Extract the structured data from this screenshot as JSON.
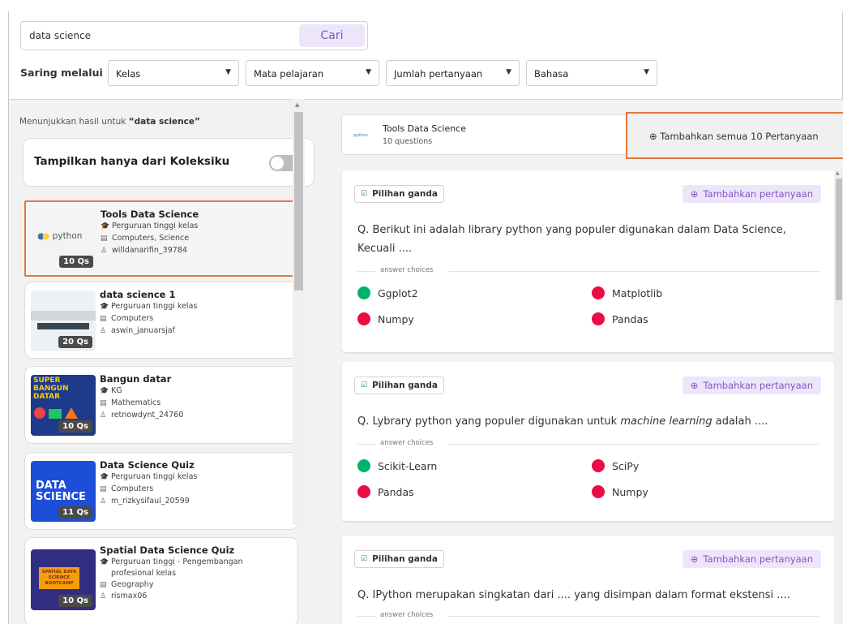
{
  "search": {
    "value": "data science",
    "button_label": "Cari"
  },
  "filters": {
    "label": "Saring melalui",
    "dropdowns": [
      {
        "label": "Kelas"
      },
      {
        "label": "Mata pelajaran"
      },
      {
        "label": "Jumlah pertanyaan"
      },
      {
        "label": "Bahasa"
      }
    ]
  },
  "left": {
    "results_prefix": "Menunjukkan hasil untuk",
    "results_query": "“data science”",
    "collection_toggle_label": "Tampilkan hanya dari Koleksiku",
    "quizzes": [
      {
        "title": "Tools Data Science",
        "grade": "Perguruan tinggi kelas",
        "subject": "Computers, Science",
        "author": "willdanarifin_39784",
        "badge": "10 Qs",
        "thumb_text": "python"
      },
      {
        "title": "data science 1",
        "grade": "Perguruan tinggi kelas",
        "subject": "Computers",
        "author": "aswin_januarsjaf",
        "badge": "20 Qs"
      },
      {
        "title": "Bangun datar",
        "grade": "KG",
        "subject": "Mathematics",
        "author": "retnowdynt_24760",
        "badge": "10 Qs",
        "thumb_text": "SUPER BANGUN DATAR"
      },
      {
        "title": "Data Science Quiz",
        "grade": "Perguruan tinggi kelas",
        "subject": "Computers",
        "author": "m_rizkysifaul_20599",
        "badge": "11 Qs",
        "thumb_text": "DATA SCIENCE"
      },
      {
        "title": "Spatial Data Science Quiz",
        "grade_line1": "Perguruan tinggi - Pengembangan",
        "grade_line2": "profesional kelas",
        "subject": "Geography",
        "author": "rismax06",
        "badge": "10 Qs",
        "thumb_text": "SPATIAL DATA SCIENCE BOOTCAMP"
      }
    ]
  },
  "right": {
    "header": {
      "title": "Tools Data Science",
      "subtitle": "10 questions",
      "add_all_label": "Tambahkan semua 10 Pertanyaan",
      "thumb_text": "python"
    },
    "type_label": "Pilihan ganda",
    "add_question_label": "Tambahkan pertanyaan",
    "answer_choices_label": "answer choices",
    "questions": [
      {
        "text": "Q. Berikut ini adalah library python yang populer digunakan dalam Data Science, Kecuali ....",
        "choices": [
          "Ggplot2",
          "Matplotlib",
          "Numpy",
          "Pandas"
        ]
      },
      {
        "text_prefix": "Q. Lybrary python yang populer digunakan untuk ",
        "text_em": "machine learning",
        "text_suffix": " adalah ....",
        "choices": [
          "Scikit-Learn",
          "SciPy",
          "Pandas",
          "Numpy"
        ]
      },
      {
        "text": "Q. IPython merupakan singkatan dari .... yang disimpan dalam format ekstensi ...."
      }
    ]
  },
  "colors": {
    "accent": "#8854c0",
    "accent_bg": "#ede6fb",
    "highlight": "#e07b39",
    "correct": "#00b36b",
    "incorrect": "#ec0b43"
  }
}
